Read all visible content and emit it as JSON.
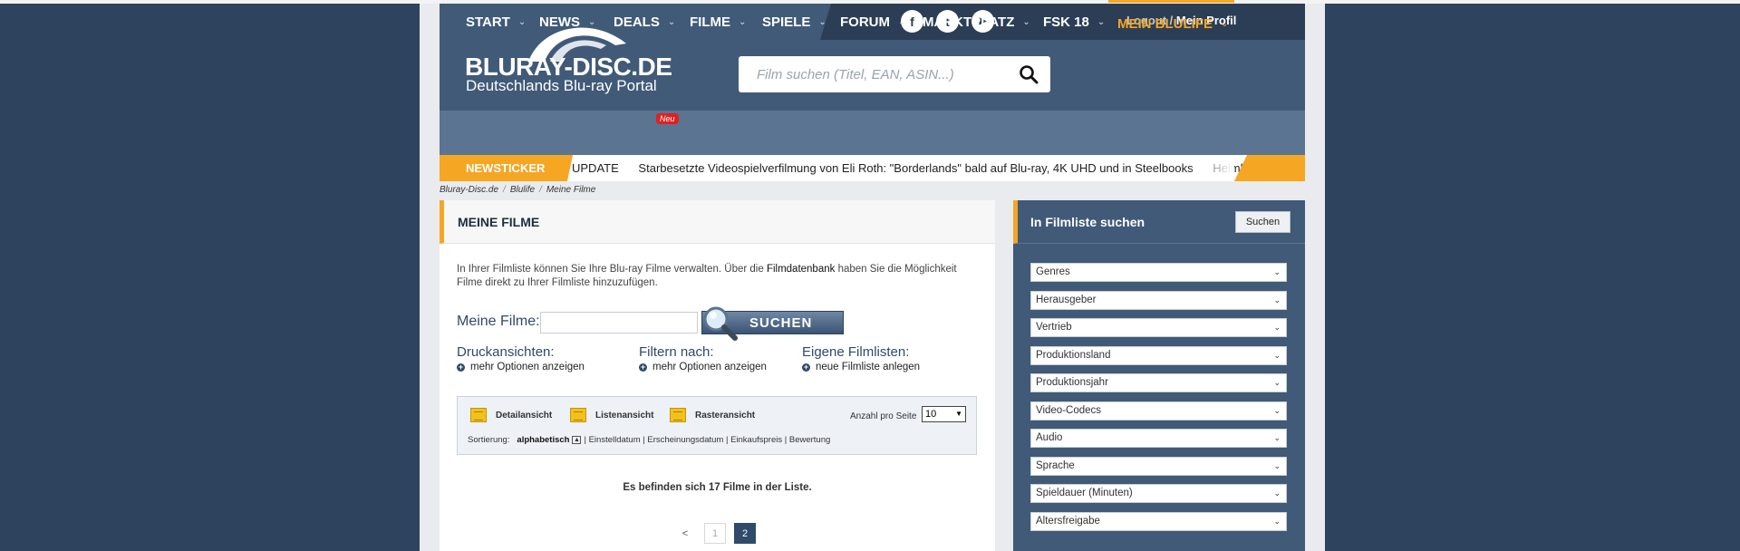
{
  "header": {
    "logo_main": "BLURAY-DISC.DE",
    "logo_sub": "Deutschlands Blu-ray Portal",
    "social": [
      {
        "icon": "facebook-icon",
        "glyph": "f"
      },
      {
        "icon": "twitter-icon",
        "glyph": "t"
      },
      {
        "icon": "youtube-icon",
        "glyph": "▶"
      }
    ],
    "logout": "Logout",
    "separator": "/",
    "profile": "Mein Profil",
    "search_placeholder": "Film suchen (Titel, EAN, ASIN...)"
  },
  "nav": {
    "items": [
      {
        "label": "START"
      },
      {
        "label": "NEWS"
      },
      {
        "label": "DEALS"
      },
      {
        "label": "FILME"
      },
      {
        "label": "SPIELE"
      },
      {
        "label": "FORUM"
      },
      {
        "label": "MARKTPLATZ"
      },
      {
        "label": "FSK 18"
      },
      {
        "label": "MEIN BLULIFE"
      }
    ],
    "deals_badge": "Neu",
    "chevron": "⌄",
    "active_color": "#f5a623"
  },
  "ticker": {
    "label": "NEWSTICKER",
    "text": "UPDATE      Starbesetzte Videospielverfilmung von Eli Roth: \"Borderlands\" bald auf Blu-ray, 4K UHD und in Steelbooks      Heimkinopre"
  },
  "breadcrumb": [
    "Bluray-Disc.de",
    "Blulife",
    "Meine Filme"
  ],
  "main": {
    "title": "MEINE FILME",
    "intro_1": "In Ihrer Filmliste können Sie Ihre Blu-ray Filme verwalten. Über die ",
    "intro_link": "Filmdatenbank",
    "intro_2": " haben Sie die Möglichkeit Filme direkt zu Ihrer Filmliste hinzuzufügen.",
    "search_label": "Meine Filme:",
    "search_button": "SUCHEN",
    "options": [
      {
        "heading": "Druckansichten:",
        "link": "mehr Optionen anzeigen"
      },
      {
        "heading": "Filtern nach:",
        "link": "mehr Optionen anzeigen"
      },
      {
        "heading": "Eigene Filmlisten:",
        "link": "neue Filmliste anlegen"
      }
    ],
    "views": [
      "Detailansicht",
      "Listenansicht",
      "Rasteransicht"
    ],
    "per_page_label": "Anzahl pro Seite",
    "per_page_value": "10",
    "sort_label": "Sortierung:",
    "sort_active": "alphabetisch",
    "sort_others": "| Einstelldatum | Erscheinungsdatum | Einkaufspreis | Bewertung",
    "count_text": "Es befinden sich 17 Filme in der Liste.",
    "pager": {
      "prev": "<",
      "pages": [
        "1",
        "2"
      ],
      "current": "2"
    }
  },
  "sidebar": {
    "title": "In Filmliste suchen",
    "button": "Suchen",
    "filters": [
      "Genres",
      "Herausgeber",
      "Vertrieb",
      "Produktionsland",
      "Produktionsjahr",
      "Video-Codecs",
      "Audio",
      "Sprache",
      "Spieldauer (Minuten)",
      "Altersfreigabe"
    ]
  },
  "colors": {
    "accent": "#f5a623",
    "header_bg": "#405a78",
    "nav_bg": "#5a7491",
    "page_bg": "#2e435d"
  }
}
